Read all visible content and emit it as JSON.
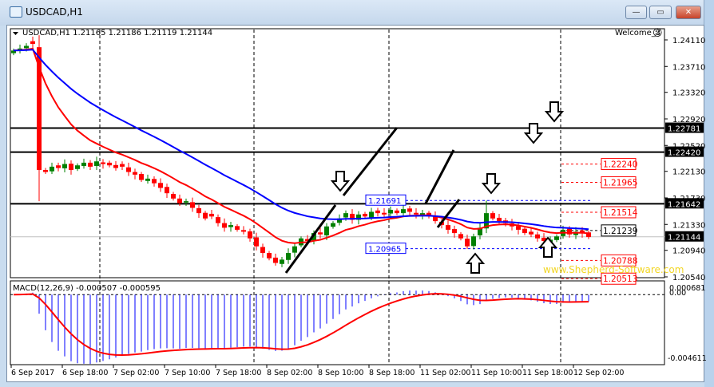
{
  "window": {
    "title": "USDCAD,H1",
    "min": "—",
    "max": "▭",
    "close": "✕"
  },
  "header": {
    "symbol_line": "USDCAD,H1  1.21165 1.21186 1.21119 1.21144",
    "expert": "Welcome_3",
    "expert_icon": "☹"
  },
  "watermark": "www.Shepherd-Software.com",
  "chart_data": {
    "type": "candlestick",
    "symbol": "USDCAD",
    "timeframe": "H1",
    "ohlc_last": {
      "open": 1.21165,
      "high": 1.21186,
      "low": 1.21119,
      "close": 1.21144
    },
    "ylim": [
      1.2038,
      1.246
    ],
    "y_ticks": [
      "1.24110",
      "1.23710",
      "1.23320",
      "1.22920",
      "1.22520",
      "1.22130",
      "1.21730",
      "1.21330",
      "1.20940",
      "1.20540"
    ],
    "x_ticks": [
      "6 Sep 2017",
      "6 Sep 18:00",
      "7 Sep 02:00",
      "7 Sep 10:00",
      "7 Sep 18:00",
      "8 Sep 02:00",
      "8 Sep 10:00",
      "8 Sep 18:00",
      "11 Sep 02:00",
      "11 Sep 10:00",
      "11 Sep 18:00",
      "12 Sep 02:00"
    ],
    "closes": [
      1.2395,
      1.2398,
      1.2402,
      1.2405,
      1.2215,
      1.2212,
      1.222,
      1.2218,
      1.2224,
      1.2215,
      1.2222,
      1.2226,
      1.222,
      1.2228,
      1.2224,
      1.2222,
      1.2218,
      1.222,
      1.2212,
      1.2208,
      1.22,
      1.2202,
      1.2195,
      1.2188,
      1.218,
      1.2172,
      1.2165,
      1.2168,
      1.2158,
      1.215,
      1.2142,
      1.2145,
      1.2135,
      1.2128,
      1.2132,
      1.2125,
      1.2122,
      1.2112,
      1.21,
      1.209,
      1.2082,
      1.2075,
      1.208,
      1.209,
      1.21,
      1.2112,
      1.2108,
      1.212,
      1.2118,
      1.213,
      1.2135,
      1.2142,
      1.215,
      1.214,
      1.2148,
      1.2145,
      1.2152,
      1.215,
      1.2148,
      1.2155,
      1.215,
      1.2156,
      1.2152,
      1.2148,
      1.215,
      1.2145,
      1.2138,
      1.2132,
      1.2125,
      1.212,
      1.2112,
      1.21,
      1.2115,
      1.2128,
      1.215,
      1.2142,
      1.2138,
      1.2135,
      1.213,
      1.2125,
      1.212,
      1.2118,
      1.2112,
      1.2108,
      1.211,
      1.2115,
      1.2125,
      1.2118,
      1.2122,
      1.212,
      1.2114
    ],
    "big_bar_index": 4,
    "moving_averages": [
      {
        "name": "fast MA",
        "color": "#ff0000",
        "period": 12
      },
      {
        "name": "slow MA",
        "color": "#0000ff",
        "period": 30
      }
    ],
    "horizontal_lines": [
      {
        "price": "1.22781",
        "style": "solid",
        "color": "#000000"
      },
      {
        "price": "1.22420",
        "style": "solid",
        "color": "#000000"
      },
      {
        "price": "1.21642",
        "style": "solid",
        "color": "#000000"
      }
    ],
    "level_labels": [
      {
        "price": "1.21691",
        "color": "#0000ff"
      },
      {
        "price": "1.20965",
        "color": "#0000ff"
      }
    ],
    "target_labels": [
      {
        "price": "1.22240",
        "color": "#ff0000"
      },
      {
        "price": "1.21965",
        "color": "#ff0000"
      },
      {
        "price": "1.21514",
        "color": "#ff0000"
      },
      {
        "price": "1.21239",
        "color": "#000000"
      },
      {
        "price": "1.20788",
        "color": "#ff0000"
      },
      {
        "price": "1.20513",
        "color": "#ff0000"
      }
    ],
    "current_price": "1.21144",
    "macd": {
      "label": "MACD(12,26,9) -0.000507 -0.000595",
      "ymax": "0.000681",
      "zero": "0.00",
      "ymin": "-0.004611",
      "hist_color": "#0000ff",
      "signal_color": "#ff0000"
    }
  }
}
